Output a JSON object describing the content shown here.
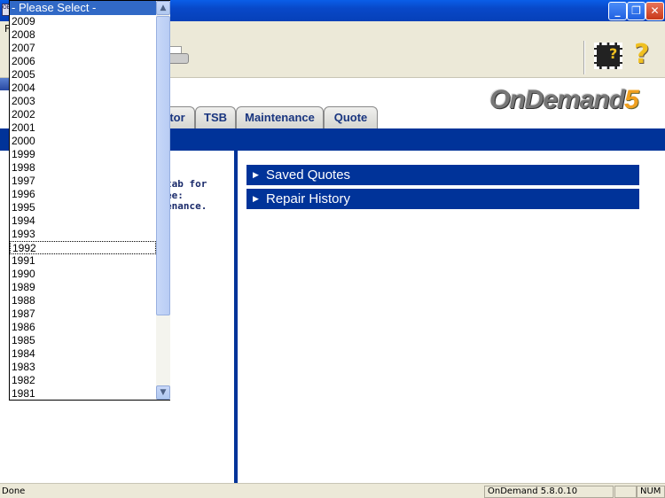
{
  "window": {
    "icon_text": "OE",
    "min": "_",
    "restore": "❐",
    "close": "✕"
  },
  "menu": {
    "first": "F"
  },
  "toolbar": {
    "help": "?"
  },
  "logo": {
    "text": "OnDemand",
    "num": "5"
  },
  "tabs": [
    "tor",
    "TSB",
    "Maintenance",
    "Quote"
  ],
  "left_text": [
    "tab for",
    "ee:",
    "enance."
  ],
  "sections": [
    "Saved Quotes",
    "Repair History"
  ],
  "status": {
    "text": "Done",
    "version": "OnDemand 5.8.0.10",
    "blank": "",
    "num": "NUM"
  },
  "dropdown": {
    "selected": "- Please Select -",
    "focused": "1992",
    "options": [
      "2009",
      "2008",
      "2007",
      "2006",
      "2005",
      "2004",
      "2003",
      "2002",
      "2001",
      "2000",
      "1999",
      "1998",
      "1997",
      "1996",
      "1995",
      "1994",
      "1993",
      "1992",
      "1991",
      "1990",
      "1989",
      "1988",
      "1987",
      "1986",
      "1985",
      "1984",
      "1983",
      "1982",
      "1981"
    ]
  },
  "colors": {
    "accent": "#003399",
    "selection": "#3169c6"
  }
}
